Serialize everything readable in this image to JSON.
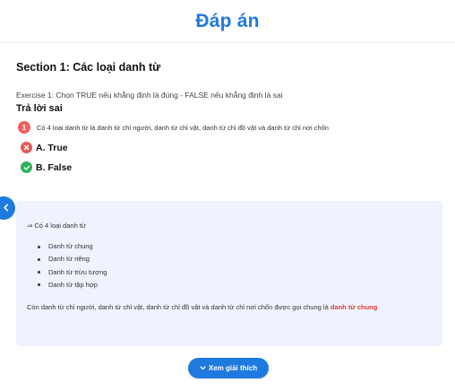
{
  "header": {
    "title": "Đáp án"
  },
  "section": {
    "title": "Section 1: Các loại danh từ"
  },
  "exercise": {
    "instruction": "Exercise 1: Chọn TRUE nếu khẳng định là đúng - FALSE nếu khẳng định là sai",
    "answer_heading": "Trả lời sai",
    "question_number": "1",
    "question_text": "Có 4 loại danh từ là danh từ chỉ người, danh từ chỉ vật, danh từ chỉ đồ vật và danh từ chỉ nơi chốn",
    "options": [
      {
        "label": "A. True",
        "status": "wrong",
        "icon": "x-circle-icon"
      },
      {
        "label": "B. False",
        "status": "correct",
        "icon": "check-circle-icon"
      }
    ]
  },
  "explanation": {
    "arrow_line": "⇒ Có 4 loại danh từ",
    "bullets": [
      "Danh từ chung",
      "Danh từ riêng",
      "Danh từ trừu tượng",
      "Danh từ tập hợp"
    ],
    "conclusion_text": "Còn danh từ chỉ người, danh từ chỉ vật, danh từ chỉ đồ vật và danh từ chỉ nơi chốn được gọi chung là ",
    "conclusion_highlight": "danh từ chung"
  },
  "actions": {
    "explain_button_label": "Xem giải thích",
    "side_toggle_icon": "chevron-left-icon",
    "explain_button_icon": "chevron-down-icon"
  },
  "colors": {
    "accent": "#1f7ae0",
    "wrong": "#e65a5a",
    "correct": "#2fb35a",
    "highlight": "#e03b3b",
    "explain_bg": "#eef3fd"
  }
}
